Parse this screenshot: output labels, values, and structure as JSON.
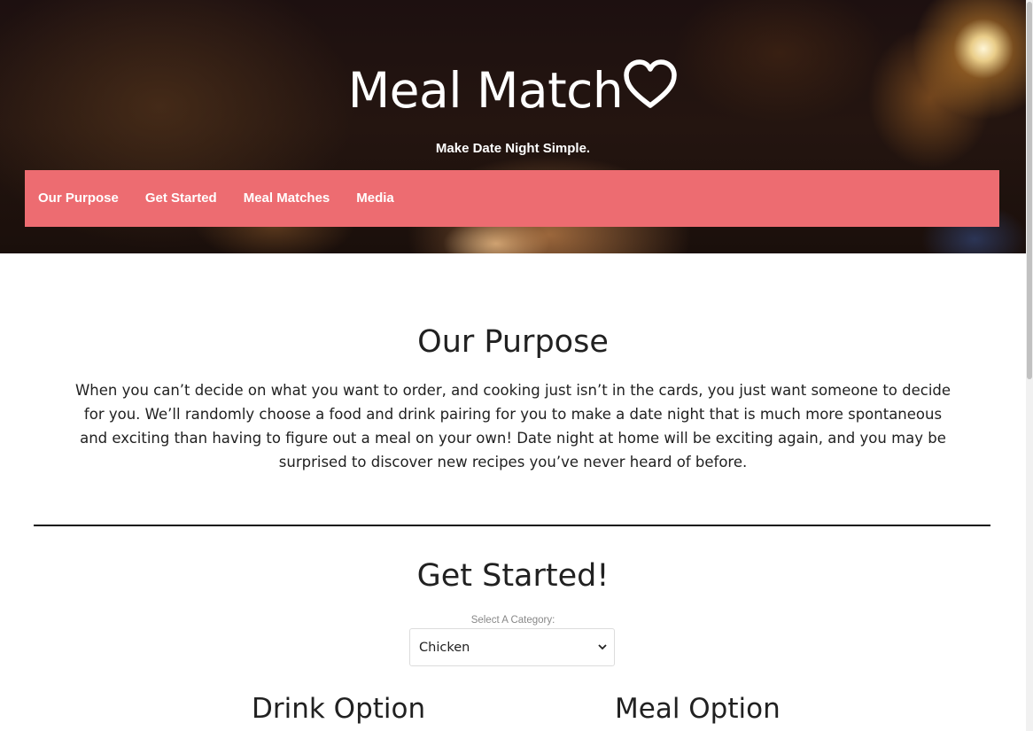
{
  "header": {
    "title": "Meal Match",
    "title_icon": "heart-outline-icon",
    "tagline": "Make Date Night Simple."
  },
  "nav": {
    "items": [
      {
        "label": "Our Purpose"
      },
      {
        "label": "Get Started"
      },
      {
        "label": "Meal Matches"
      },
      {
        "label": "Media"
      }
    ],
    "background_color": "#ed6c71"
  },
  "purpose": {
    "heading": "Our Purpose",
    "body": "When you can’t decide on what you want to order, and cooking just isn’t in the cards, you just want someone to decide for you. We’ll randomly choose a food and drink pairing for you to make a date night that is much more spontaneous and exciting than having to figure out a meal on your own! Date night at home will be exciting again, and you may be surprised to discover new recipes you’ve never heard of before."
  },
  "get_started": {
    "heading": "Get Started!",
    "select_label": "Select A Category:",
    "selected_category": "Chicken"
  },
  "options": {
    "drink_heading": "Drink Option",
    "meal_heading": "Meal Option"
  }
}
